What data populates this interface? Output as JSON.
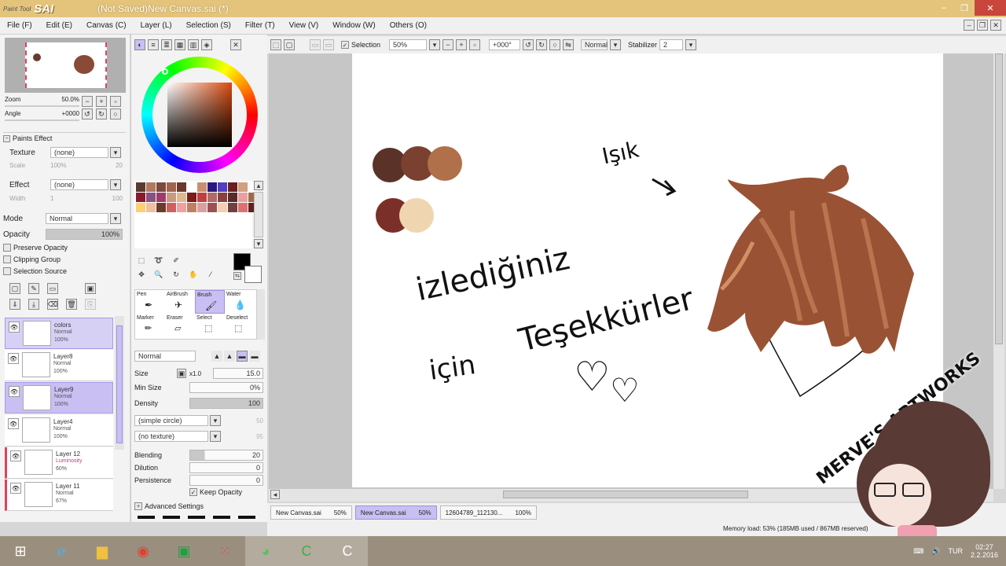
{
  "window": {
    "app_logo_small": "Paint Tool",
    "app_logo": "SAI",
    "title": "(Not Saved)New Canvas.sai (*)",
    "min": "–",
    "max": "❐",
    "close": "✕"
  },
  "menu": [
    "File (F)",
    "Edit (E)",
    "Canvas (C)",
    "Layer (L)",
    "Selection (S)",
    "Filter (T)",
    "View (V)",
    "Window (W)",
    "Others (O)"
  ],
  "navigator": {
    "zoom_label": "Zoom",
    "zoom_value": "50.0%",
    "angle_label": "Angle",
    "angle_value": "+0000"
  },
  "paper_effect": {
    "header": "Paints Effect",
    "texture_label": "Texture",
    "texture_value": "(none)",
    "effect_label": "Effect",
    "effect_value": "(none)",
    "scale_label": "Scale",
    "scale_value": "100%",
    "scale_num": "20",
    "width_label": "Width",
    "width_value": "1",
    "width_num": "100"
  },
  "layer_props": {
    "mode_label": "Mode",
    "mode_value": "Normal",
    "opacity_label": "Opacity",
    "opacity_value": "100%",
    "preserve": "Preserve Opacity",
    "clipping": "Clipping Group",
    "source": "Selection Source"
  },
  "layers": [
    {
      "name": "colors",
      "mode": "Normal",
      "opacity": "100%"
    },
    {
      "name": "Layer8",
      "mode": "Normal",
      "opacity": "100%"
    },
    {
      "name": "Layer9",
      "mode": "Normal",
      "opacity": "100%"
    },
    {
      "name": "Layer4",
      "mode": "Normal",
      "opacity": "100%"
    },
    {
      "name": "Layer 12",
      "mode": "Luminosity",
      "opacity": "60%"
    },
    {
      "name": "Layer 11",
      "mode": "Normal",
      "opacity": "67%"
    }
  ],
  "colors": {
    "current": "#000000",
    "secondary": "#ffffff",
    "accent": "#c9bff2"
  },
  "swatches": [
    "#5a3a30",
    "#b07860",
    "#7a4a40",
    "#a0644e",
    "#6a3830",
    "#ffffff",
    "#c89070",
    "#2a1a80",
    "#5040c0",
    "#6a2020",
    "#d0a080",
    "#ffffff",
    "#8a1a2a",
    "#8a5080",
    "#a03a6a",
    "#c89a80",
    "#e0b890",
    "#7a1a1a",
    "#c04040",
    "#b06a6a",
    "#8a4040",
    "#5a2a2a",
    "#e8a0a0",
    "#a06a4a",
    "#ffd070",
    "#f0c0a0",
    "#6a3a2a",
    "#d06060",
    "#f0a0a0",
    "#c08060",
    "#d8a0a0",
    "#a05050",
    "#f0d0b0",
    "#704040",
    "#e07070",
    "#602020"
  ],
  "tools": {
    "row1": [
      "Pen",
      "AirBrush",
      "Brush",
      "Water"
    ],
    "row2": [
      "Marker",
      "Eraser",
      "Select",
      "Deselect"
    ],
    "active": "Brush"
  },
  "brush": {
    "mode": "Normal",
    "size_label": "Size",
    "size_mult": "x1.0",
    "size_value": "15.0",
    "minsize_label": "Min Size",
    "minsize_value": "0%",
    "density_label": "Density",
    "density_value": "100",
    "shape": "(simple circle)",
    "shape_num": "50",
    "texture": "(no texture)",
    "texture_num": "95",
    "blending_label": "Blending",
    "blending_value": "20",
    "dilution_label": "Dilution",
    "dilution_value": "0",
    "persistence_label": "Persistence",
    "persistence_value": "0",
    "keep_opacity": "Keep Opacity",
    "advanced": "Advanced Settings"
  },
  "toolbar": {
    "selection": "Selection",
    "zoom": "50%",
    "angle": "+000°",
    "mode": "Normal",
    "stabilizer_label": "Stabilizer",
    "stabilizer_value": "2"
  },
  "canvas_text": {
    "light": "Işık",
    "thanks1": "izlediğiniz",
    "thanks2": "için",
    "thanks3": "Teşekkürler",
    "watermark": "MERVE'S ARTWORKS"
  },
  "tabs": [
    {
      "name": "New Canvas.sai",
      "zoom": "50%",
      "active": false
    },
    {
      "name": "New Canvas.sai",
      "zoom": "50%",
      "active": true
    },
    {
      "name": "12604789_112130...",
      "zoom": "100%",
      "active": false
    }
  ],
  "status": {
    "memory": "Memory load: 53% (185MB used / 867MB reserved)"
  },
  "taskbar": {
    "lang": "TUR",
    "time": "02:27",
    "date": "2.2.2016"
  }
}
